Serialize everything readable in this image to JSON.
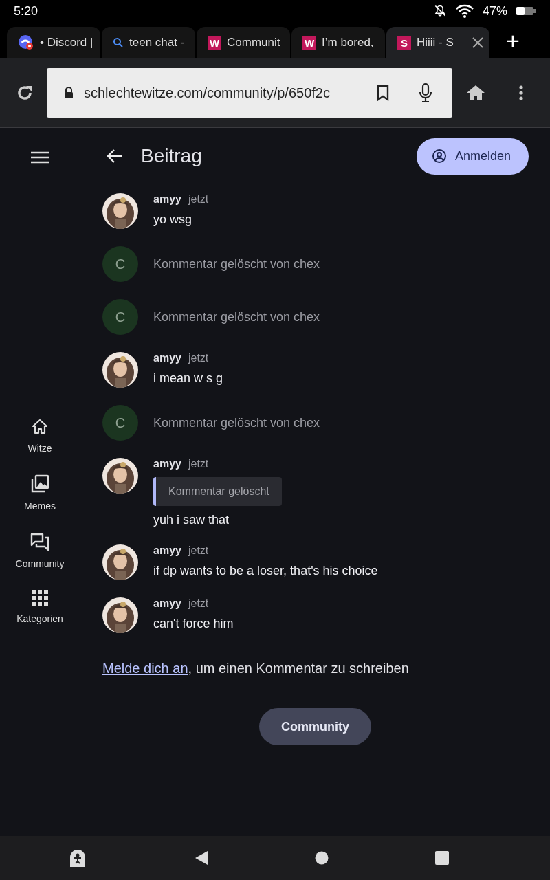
{
  "status_bar": {
    "time": "5:20",
    "battery": "47%"
  },
  "tabs": [
    {
      "kind": "discord",
      "title": "• Discord |",
      "selected": false
    },
    {
      "kind": "search",
      "title": "teen chat -",
      "selected": false
    },
    {
      "kind": "letter",
      "letter": "W",
      "title": "Communit",
      "selected": false
    },
    {
      "kind": "letter",
      "letter": "W",
      "title": "I’m bored,",
      "selected": false
    },
    {
      "kind": "letter",
      "letter": "S",
      "title": "Hiiii - S",
      "selected": true
    }
  ],
  "new_tab": "+",
  "address_bar": {
    "url": "schlechtewitze.com/community/p/650f2c"
  },
  "sidebar": {
    "items": [
      {
        "label": "Witze"
      },
      {
        "label": "Memes"
      },
      {
        "label": "Community"
      },
      {
        "label": "Kategorien"
      }
    ]
  },
  "header": {
    "title": "Beitrag",
    "login_button": "Anmelden"
  },
  "comments": [
    {
      "kind": "user",
      "author": "amyy",
      "time": "jetzt",
      "text": "yo wsg"
    },
    {
      "kind": "deleted",
      "initial": "C",
      "text": "Kommentar gelöscht von chex"
    },
    {
      "kind": "deleted",
      "initial": "C",
      "text": "Kommentar gelöscht von chex"
    },
    {
      "kind": "user",
      "author": "amyy",
      "time": "jetzt",
      "text": "i mean w s g"
    },
    {
      "kind": "deleted",
      "initial": "C",
      "text": "Kommentar gelöscht von chex"
    },
    {
      "kind": "user",
      "author": "amyy",
      "time": "jetzt",
      "quote": "Kommentar gelöscht",
      "text": "yuh i saw that"
    },
    {
      "kind": "user",
      "author": "amyy",
      "time": "jetzt",
      "text": "if dp wants to be a loser, that's his choice"
    },
    {
      "kind": "user",
      "author": "amyy",
      "time": "jetzt",
      "text": "can't force him"
    }
  ],
  "login_prompt": {
    "link": "Melde dich an",
    "text": ", um einen Kommentar zu schreiben"
  },
  "community_button": "Community"
}
